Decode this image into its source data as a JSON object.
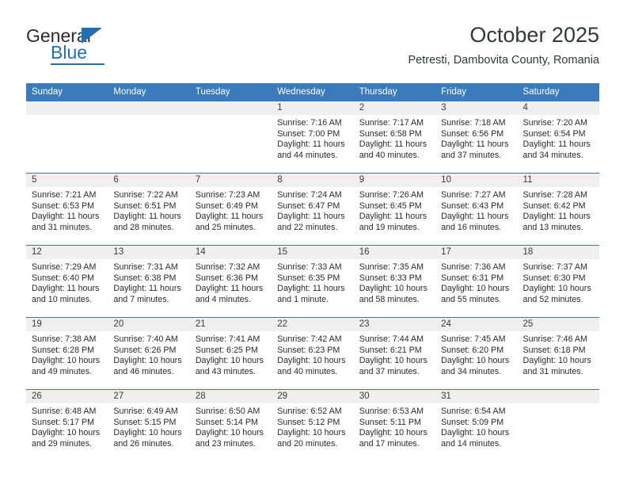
{
  "logo": {
    "word_top": "General",
    "word_bottom": "Blue",
    "accent_color": "#1f6fb4"
  },
  "header": {
    "title": "October 2025",
    "location": "Petresti, Dambovita County, Romania"
  },
  "theme": {
    "header_row_bg": "#3a7cbb",
    "daynum_band_bg": "#efefef",
    "week_divider": "#2f7ac0",
    "text": "#2a2a2a"
  },
  "calendar": {
    "weekday_headers": [
      "Sunday",
      "Monday",
      "Tuesday",
      "Wednesday",
      "Thursday",
      "Friday",
      "Saturday"
    ],
    "labels": {
      "sunrise": "Sunrise:",
      "sunset": "Sunset:",
      "daylight": "Daylight:"
    },
    "weeks": [
      [
        {
          "day": "",
          "empty": true
        },
        {
          "day": "",
          "empty": true
        },
        {
          "day": "",
          "empty": true
        },
        {
          "day": "1",
          "sunrise": "Sunrise: 7:16 AM",
          "sunset": "Sunset: 7:00 PM",
          "daylight_1": "Daylight: 11 hours",
          "daylight_2": "and 44 minutes."
        },
        {
          "day": "2",
          "sunrise": "Sunrise: 7:17 AM",
          "sunset": "Sunset: 6:58 PM",
          "daylight_1": "Daylight: 11 hours",
          "daylight_2": "and 40 minutes."
        },
        {
          "day": "3",
          "sunrise": "Sunrise: 7:18 AM",
          "sunset": "Sunset: 6:56 PM",
          "daylight_1": "Daylight: 11 hours",
          "daylight_2": "and 37 minutes."
        },
        {
          "day": "4",
          "sunrise": "Sunrise: 7:20 AM",
          "sunset": "Sunset: 6:54 PM",
          "daylight_1": "Daylight: 11 hours",
          "daylight_2": "and 34 minutes."
        }
      ],
      [
        {
          "day": "5",
          "sunrise": "Sunrise: 7:21 AM",
          "sunset": "Sunset: 6:53 PM",
          "daylight_1": "Daylight: 11 hours",
          "daylight_2": "and 31 minutes."
        },
        {
          "day": "6",
          "sunrise": "Sunrise: 7:22 AM",
          "sunset": "Sunset: 6:51 PM",
          "daylight_1": "Daylight: 11 hours",
          "daylight_2": "and 28 minutes."
        },
        {
          "day": "7",
          "sunrise": "Sunrise: 7:23 AM",
          "sunset": "Sunset: 6:49 PM",
          "daylight_1": "Daylight: 11 hours",
          "daylight_2": "and 25 minutes."
        },
        {
          "day": "8",
          "sunrise": "Sunrise: 7:24 AM",
          "sunset": "Sunset: 6:47 PM",
          "daylight_1": "Daylight: 11 hours",
          "daylight_2": "and 22 minutes."
        },
        {
          "day": "9",
          "sunrise": "Sunrise: 7:26 AM",
          "sunset": "Sunset: 6:45 PM",
          "daylight_1": "Daylight: 11 hours",
          "daylight_2": "and 19 minutes."
        },
        {
          "day": "10",
          "sunrise": "Sunrise: 7:27 AM",
          "sunset": "Sunset: 6:43 PM",
          "daylight_1": "Daylight: 11 hours",
          "daylight_2": "and 16 minutes."
        },
        {
          "day": "11",
          "sunrise": "Sunrise: 7:28 AM",
          "sunset": "Sunset: 6:42 PM",
          "daylight_1": "Daylight: 11 hours",
          "daylight_2": "and 13 minutes."
        }
      ],
      [
        {
          "day": "12",
          "sunrise": "Sunrise: 7:29 AM",
          "sunset": "Sunset: 6:40 PM",
          "daylight_1": "Daylight: 11 hours",
          "daylight_2": "and 10 minutes."
        },
        {
          "day": "13",
          "sunrise": "Sunrise: 7:31 AM",
          "sunset": "Sunset: 6:38 PM",
          "daylight_1": "Daylight: 11 hours",
          "daylight_2": "and 7 minutes."
        },
        {
          "day": "14",
          "sunrise": "Sunrise: 7:32 AM",
          "sunset": "Sunset: 6:36 PM",
          "daylight_1": "Daylight: 11 hours",
          "daylight_2": "and 4 minutes."
        },
        {
          "day": "15",
          "sunrise": "Sunrise: 7:33 AM",
          "sunset": "Sunset: 6:35 PM",
          "daylight_1": "Daylight: 11 hours",
          "daylight_2": "and 1 minute."
        },
        {
          "day": "16",
          "sunrise": "Sunrise: 7:35 AM",
          "sunset": "Sunset: 6:33 PM",
          "daylight_1": "Daylight: 10 hours",
          "daylight_2": "and 58 minutes."
        },
        {
          "day": "17",
          "sunrise": "Sunrise: 7:36 AM",
          "sunset": "Sunset: 6:31 PM",
          "daylight_1": "Daylight: 10 hours",
          "daylight_2": "and 55 minutes."
        },
        {
          "day": "18",
          "sunrise": "Sunrise: 7:37 AM",
          "sunset": "Sunset: 6:30 PM",
          "daylight_1": "Daylight: 10 hours",
          "daylight_2": "and 52 minutes."
        }
      ],
      [
        {
          "day": "19",
          "sunrise": "Sunrise: 7:38 AM",
          "sunset": "Sunset: 6:28 PM",
          "daylight_1": "Daylight: 10 hours",
          "daylight_2": "and 49 minutes."
        },
        {
          "day": "20",
          "sunrise": "Sunrise: 7:40 AM",
          "sunset": "Sunset: 6:26 PM",
          "daylight_1": "Daylight: 10 hours",
          "daylight_2": "and 46 minutes."
        },
        {
          "day": "21",
          "sunrise": "Sunrise: 7:41 AM",
          "sunset": "Sunset: 6:25 PM",
          "daylight_1": "Daylight: 10 hours",
          "daylight_2": "and 43 minutes."
        },
        {
          "day": "22",
          "sunrise": "Sunrise: 7:42 AM",
          "sunset": "Sunset: 6:23 PM",
          "daylight_1": "Daylight: 10 hours",
          "daylight_2": "and 40 minutes."
        },
        {
          "day": "23",
          "sunrise": "Sunrise: 7:44 AM",
          "sunset": "Sunset: 6:21 PM",
          "daylight_1": "Daylight: 10 hours",
          "daylight_2": "and 37 minutes."
        },
        {
          "day": "24",
          "sunrise": "Sunrise: 7:45 AM",
          "sunset": "Sunset: 6:20 PM",
          "daylight_1": "Daylight: 10 hours",
          "daylight_2": "and 34 minutes."
        },
        {
          "day": "25",
          "sunrise": "Sunrise: 7:46 AM",
          "sunset": "Sunset: 6:18 PM",
          "daylight_1": "Daylight: 10 hours",
          "daylight_2": "and 31 minutes."
        }
      ],
      [
        {
          "day": "26",
          "sunrise": "Sunrise: 6:48 AM",
          "sunset": "Sunset: 5:17 PM",
          "daylight_1": "Daylight: 10 hours",
          "daylight_2": "and 29 minutes."
        },
        {
          "day": "27",
          "sunrise": "Sunrise: 6:49 AM",
          "sunset": "Sunset: 5:15 PM",
          "daylight_1": "Daylight: 10 hours",
          "daylight_2": "and 26 minutes."
        },
        {
          "day": "28",
          "sunrise": "Sunrise: 6:50 AM",
          "sunset": "Sunset: 5:14 PM",
          "daylight_1": "Daylight: 10 hours",
          "daylight_2": "and 23 minutes."
        },
        {
          "day": "29",
          "sunrise": "Sunrise: 6:52 AM",
          "sunset": "Sunset: 5:12 PM",
          "daylight_1": "Daylight: 10 hours",
          "daylight_2": "and 20 minutes."
        },
        {
          "day": "30",
          "sunrise": "Sunrise: 6:53 AM",
          "sunset": "Sunset: 5:11 PM",
          "daylight_1": "Daylight: 10 hours",
          "daylight_2": "and 17 minutes."
        },
        {
          "day": "31",
          "sunrise": "Sunrise: 6:54 AM",
          "sunset": "Sunset: 5:09 PM",
          "daylight_1": "Daylight: 10 hours",
          "daylight_2": "and 14 minutes."
        },
        {
          "day": "",
          "empty": true
        }
      ]
    ]
  }
}
